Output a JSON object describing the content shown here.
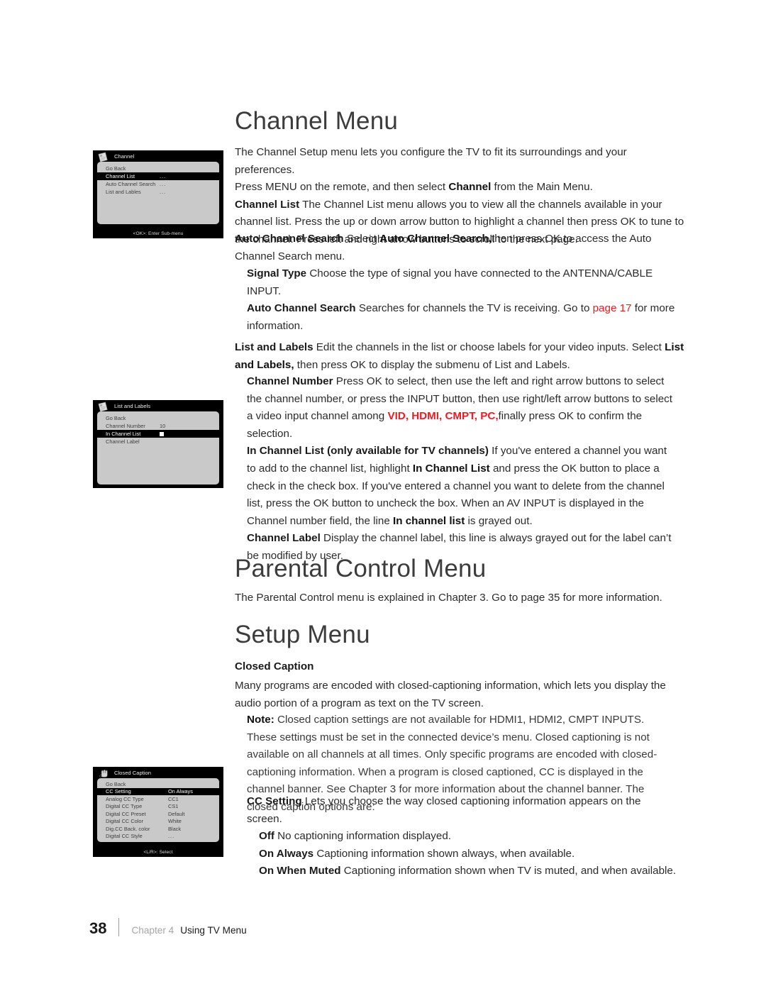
{
  "headings": {
    "channel_menu": "Channel Menu",
    "parental_control_menu": "Parental Control Menu",
    "setup_menu": "Setup Menu"
  },
  "labels": {
    "closed_caption": "Closed Caption"
  },
  "body": {
    "intro_l1": "The Channel Setup menu lets you configure the TV to fit its surroundings and your preferences.",
    "intro_l2_a": "Press MENU on the remote, and then select ",
    "intro_l2_b": "Channel",
    "intro_l2_c": " from the Main Menu.",
    "channel_list_term": "Channel List",
    "channel_list_text": "   The Channel List menu allows you to view all the channels available in your channel list. Press the up or down arrow button to highlight a channel then press OK to tune to the channel. Press left and right arrow buttons to scroll to the next page.",
    "auto_search_term": "Auto Channel Search",
    "auto_search_a": "     Select ",
    "auto_search_b": "Auto Channel Search,",
    "auto_search_c": "then press OK to access the Auto Channel Search menu.",
    "signal_type_term": "Signal Type",
    "signal_type_text": "    Choose the type of signal you have connected to the ANTENNA/CABLE INPUT.",
    "auto_search2_term": "Auto Channel Search",
    "auto_search2_a": "    Searches for channels the TV is receiving. Go to ",
    "auto_search2_link": "page 17",
    "auto_search2_b": " for more information.",
    "list_labels_term": "List and Labels",
    "list_labels_a": "   Edit the channels in the list or choose labels for your video inputs. Select ",
    "list_labels_b": "List and Labels,",
    "list_labels_c": " then press OK to display the submenu of List and Labels.",
    "channel_number_term": "Channel Number",
    "channel_number_a": "    Press OK to select, then use the left and right arrow buttons to select the channel number, or press the  INPUT button, then use right/left arrow buttons to select a video input channel among ",
    "channel_number_red": "VID, HDMI, CMPT, PC,",
    "channel_number_b": "finally press OK to confirm the selection.",
    "in_channel_list_term": "In Channel List (only available for TV channels)",
    "in_channel_list_a": "    If you've entered a channel you want to add to the channel list, highlight ",
    "in_channel_list_b": "In Channel List",
    "in_channel_list_c": " and press the  OK button to place a check in the check box. If you've entered a channel you want to delete from the channel list, press the OK button to uncheck the box. When an AV INPUT is displayed in the Channel number field, the line  ",
    "in_channel_list_d": "In channel list",
    "in_channel_list_e": "  is grayed out.",
    "channel_label_term": "Channel Label",
    "channel_label_text": "   Display the channel label, this line is always grayed out for the label can’t be modified by user.",
    "parental_text": "The Parental Control menu is explained in Chapter 3. Go to page 35 for more information.",
    "many_programs": "Many  programs are encoded with closed-captioning information, which lets you display the audio portion of a program as text on the TV screen.",
    "note_term": "Note:",
    "note_text": " Closed caption settings are not available for HDMI1, HDMI2, CMPT INPUTS. These settings must be set in the connected device’s menu. Closed captioning is not available on all channels at all times. Only specific programs are encoded with closed-captioning information. When a program is closed captioned, CC is displayed in the channel banner. See Chapter 3 for more information about the channel banner. The closed caption options are:",
    "cc_setting_term": "CC Setting",
    "cc_setting_text": "   Lets you choose the way closed captioning information appears on the screen.",
    "off_term": "Off",
    "off_text": "  No captioning information displayed.",
    "on_always_term": "On Always",
    "on_always_text": "  Captioning information shown always, when available.",
    "on_when_muted_term": "On When Muted",
    "on_when_muted_text": "   Captioning information shown when TV is muted, and when available."
  },
  "tv_menus": {
    "channel": {
      "title": "Channel",
      "icon": "page-document-icon",
      "rows": [
        {
          "label": "Go Back",
          "value": "",
          "selected": false
        },
        {
          "label": "Channel List",
          "value": "...",
          "selected": true
        },
        {
          "label": "Auto Channel Search",
          "value": "...",
          "selected": false
        },
        {
          "label": "List and Lables",
          "value": "...",
          "selected": false
        }
      ],
      "hint": "<OK>: Enter Sub-menu"
    },
    "list_and_labels": {
      "title": "List and Labels",
      "icon": "page-document-icon",
      "rows": [
        {
          "label": "Go Back",
          "value": "",
          "selected": false
        },
        {
          "label": "Channel Number",
          "value": "10",
          "selected": false
        },
        {
          "label": "In Channel List",
          "value": "checkbox",
          "selected": true
        },
        {
          "label": "Channel Label",
          "value": "",
          "selected": false
        }
      ],
      "hint": ""
    },
    "closed_caption": {
      "title": "Closed Caption",
      "icon": "hand-pointer-icon",
      "rows": [
        {
          "label": "Go Back",
          "value": "",
          "selected": false
        },
        {
          "label": "CC Setting",
          "value": "On Always",
          "selected": true
        },
        {
          "label": "Analog CC Type",
          "value": "CC1",
          "selected": false
        },
        {
          "label": "Digital CC Type",
          "value": "CS1",
          "selected": false
        },
        {
          "label": "Digital CC Preset",
          "value": "Default",
          "selected": false
        },
        {
          "label": "Digital CC Color",
          "value": "White",
          "selected": false
        },
        {
          "label": "Dig.CC Back. color",
          "value": "Black",
          "selected": false
        },
        {
          "label": "Digital CC Style",
          "value": "...",
          "selected": false
        }
      ],
      "hint": "<L/R>: Select"
    }
  },
  "footer": {
    "page_number": "38",
    "chapter": "Chapter 4",
    "chapter_title": "Using TV Menu"
  },
  "colors": {
    "accent_red": "#ed1c24",
    "heading_gray": "#3c3c3c",
    "menu_panel": "#c9c9c9",
    "menu_bg": "#000000"
  }
}
